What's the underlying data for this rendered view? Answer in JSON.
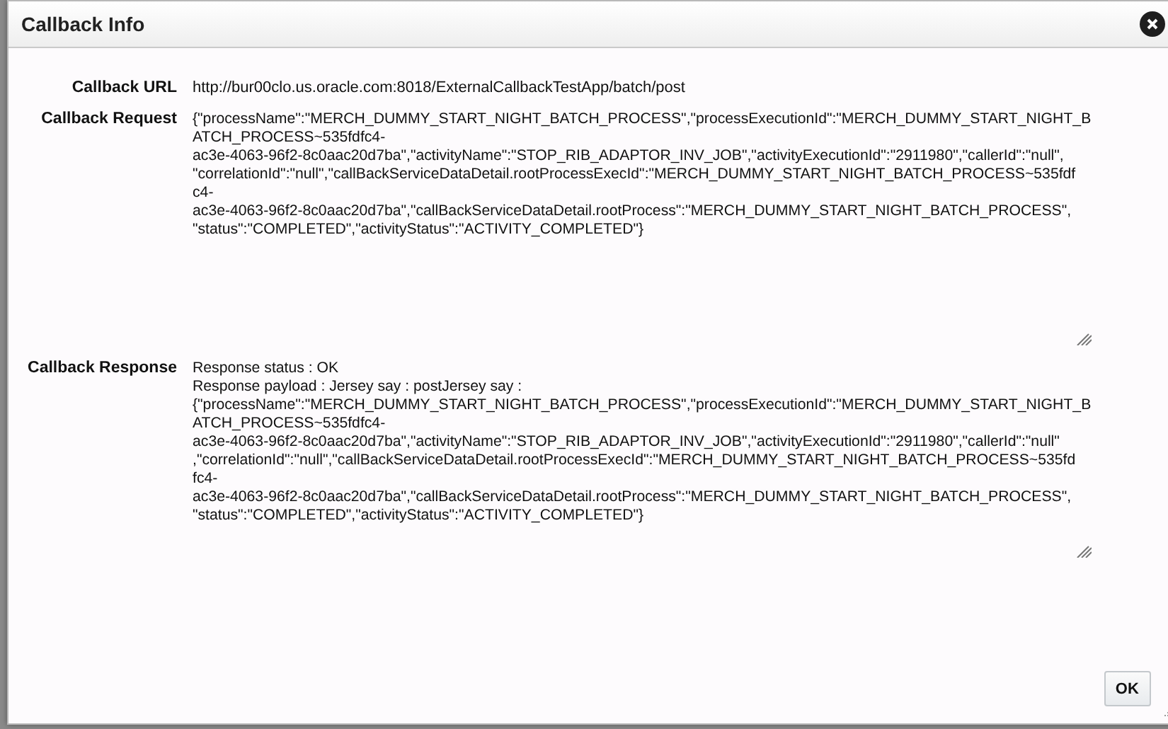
{
  "dialog": {
    "title": "Callback Info"
  },
  "fields": [
    {
      "label": "Callback URL",
      "kind": "text",
      "value": "http://bur00clo.us.oracle.com:8018/ExternalCallbackTestApp/batch/post"
    },
    {
      "label": "Callback Request",
      "kind": "textarea",
      "value": "{\"processName\":\"MERCH_DUMMY_START_NIGHT_BATCH_PROCESS\",\"processExecutionId\":\"MERCH_DUMMY_START_NIGHT_B\nATCH_PROCESS~535fdfc4-\nac3e-4063-96f2-8c0aac20d7ba\",\"activityName\":\"STOP_RIB_ADAPTOR_INV_JOB\",\"activityExecutionId\":\"2911980\",\"callerId\":\"null\",\n\"correlationId\":\"null\",\"callBackServiceDataDetail.rootProcessExecId\":\"MERCH_DUMMY_START_NIGHT_BATCH_PROCESS~535fdf\nc4-\nac3e-4063-96f2-8c0aac20d7ba\",\"callBackServiceDataDetail.rootProcess\":\"MERCH_DUMMY_START_NIGHT_BATCH_PROCESS\",\n\"status\":\"COMPLETED\",\"activityStatus\":\"ACTIVITY_COMPLETED\"}"
    },
    {
      "label": "Callback Response",
      "kind": "textarea",
      "value": "Response status : OK\nResponse payload : Jersey say : postJersey say :\n{\"processName\":\"MERCH_DUMMY_START_NIGHT_BATCH_PROCESS\",\"processExecutionId\":\"MERCH_DUMMY_START_NIGHT_B\nATCH_PROCESS~535fdfc4-\nac3e-4063-96f2-8c0aac20d7ba\",\"activityName\":\"STOP_RIB_ADAPTOR_INV_JOB\",\"activityExecutionId\":\"2911980\",\"callerId\":\"null\"\n,\"correlationId\":\"null\",\"callBackServiceDataDetail.rootProcessExecId\":\"MERCH_DUMMY_START_NIGHT_BATCH_PROCESS~535fd\nfc4-\nac3e-4063-96f2-8c0aac20d7ba\",\"callBackServiceDataDetail.rootProcess\":\"MERCH_DUMMY_START_NIGHT_BATCH_PROCESS\",\n\"status\":\"COMPLETED\",\"activityStatus\":\"ACTIVITY_COMPLETED\"}"
    }
  ],
  "buttons": [
    "OK"
  ]
}
